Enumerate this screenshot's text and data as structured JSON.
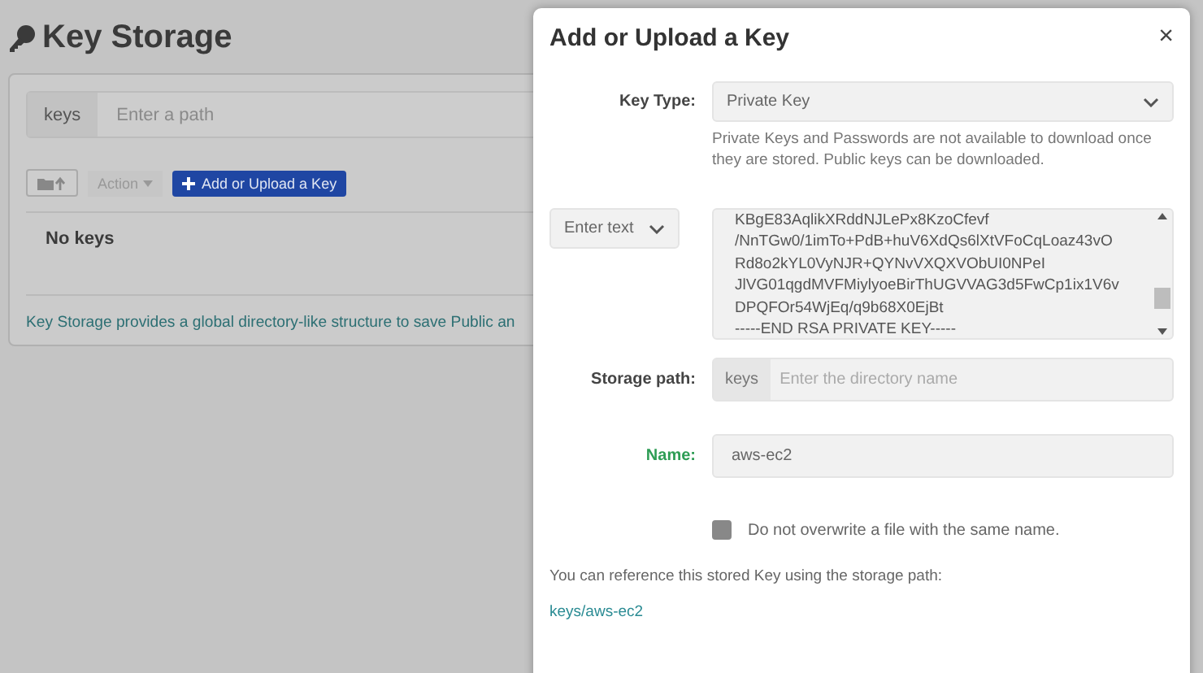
{
  "page": {
    "title": "Key Storage",
    "path_prefix": "keys",
    "path_placeholder": "Enter a path",
    "action_button": "Action",
    "add_button": "Add or Upload a Key",
    "empty_text": "No keys",
    "help_text": "Key Storage provides a global directory-like structure to save Public an"
  },
  "modal": {
    "title": "Add or Upload a Key",
    "close": "×",
    "key_type": {
      "label": "Key Type:",
      "value": "Private Key",
      "help": "Private Keys and Passwords are not available to download once they are stored. Public keys can be downloaded."
    },
    "input_mode": {
      "value": "Enter text"
    },
    "key_text": [
      "KBgE83AqlikXRddNJLePx8KzoCfevf",
      "/NnTGw0/1imTo+PdB+huV6XdQs6lXtVFoCqLoaz43vO",
      "Rd8o2kYL0VyNJR+QYNvVXQXVObUI0NPeI",
      "JlVG01qgdMVFMiylyoeBirThUGVVAG3d5FwCp1ix1V6v",
      "DPQFOr54WjEq/q9b68X0EjBt",
      "-----END RSA PRIVATE KEY-----"
    ],
    "storage_path": {
      "label": "Storage path:",
      "prefix": "keys",
      "placeholder": "Enter the directory name"
    },
    "name": {
      "label": "Name:",
      "value": "aws-ec2"
    },
    "overwrite": {
      "label": "Do not overwrite a file with the same name.",
      "checked": false
    },
    "reference_text": "You can reference this stored Key using the storage path:",
    "reference_link": "keys/aws-ec2"
  }
}
